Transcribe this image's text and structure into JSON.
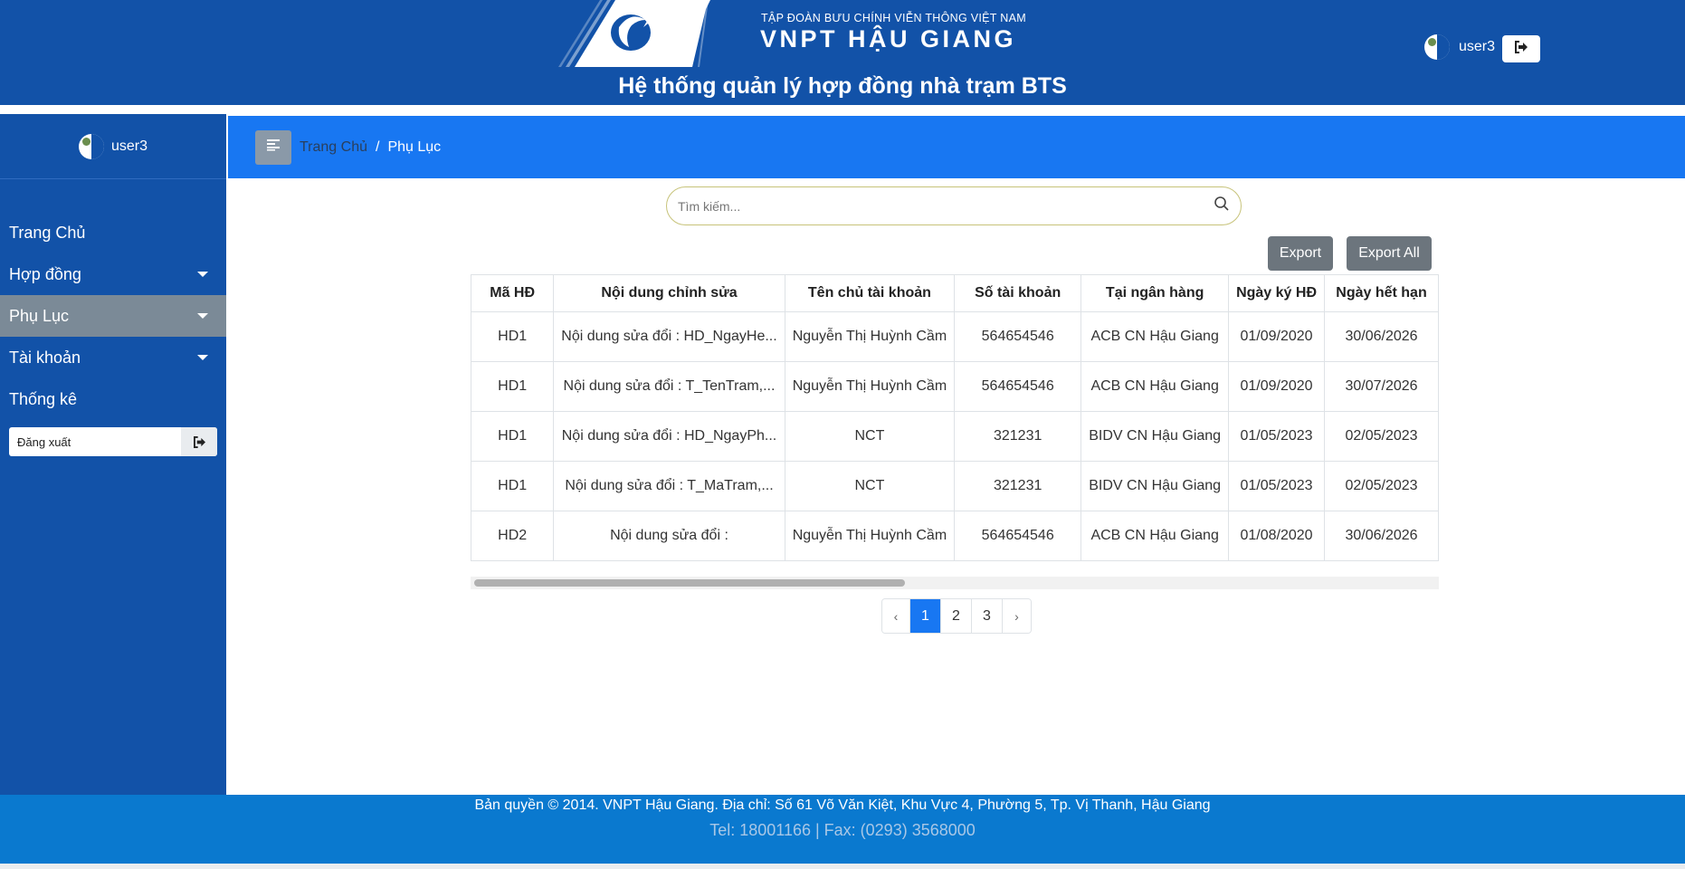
{
  "header": {
    "brand_sub": "TẬP ĐOÀN BƯU CHÍNH VIỄN THÔNG VIỆT NAM",
    "brand_main": "VNPT HẬU GIANG",
    "system_title": "Hệ thống quản lý hợp đồng nhà trạm BTS",
    "username": "user3"
  },
  "sidebar": {
    "username": "user3",
    "items": [
      {
        "label": "Trang Chủ",
        "has_caret": false,
        "active": false
      },
      {
        "label": "Hợp đồng",
        "has_caret": true,
        "active": false
      },
      {
        "label": "Phụ Lục",
        "has_caret": true,
        "active": true
      },
      {
        "label": "Tài khoản",
        "has_caret": true,
        "active": false
      },
      {
        "label": "Thống kê",
        "has_caret": false,
        "active": false
      }
    ],
    "logout_label": "Đăng xuất"
  },
  "breadcrumb": {
    "home": "Trang Chủ",
    "separator": "/",
    "current": "Phụ Lục"
  },
  "search": {
    "placeholder": "Tìm kiếm...",
    "value": ""
  },
  "toolbar": {
    "export_label": "Export",
    "export_all_label": "Export All"
  },
  "table": {
    "columns": [
      "Mã HĐ",
      "Nội dung chỉnh sửa",
      "Tên chủ tài khoản",
      "Số tài khoản",
      "Tại ngân hàng",
      "Ngày ký HĐ",
      "Ngày hết hạn"
    ],
    "rows": [
      [
        "HD1",
        "Nội dung sửa đổi : HD_NgayHe...",
        "Nguyễn Thị Huỳnh Cầm",
        "564654546",
        "ACB CN Hậu Giang",
        "01/09/2020",
        "30/06/2026"
      ],
      [
        "HD1",
        "Nội dung sửa đổi : T_TenTram,...",
        "Nguyễn Thị Huỳnh Cầm",
        "564654546",
        "ACB CN Hậu Giang",
        "01/09/2020",
        "30/07/2026"
      ],
      [
        "HD1",
        "Nội dung sửa đổi : HD_NgayPh...",
        "NCT",
        "321231",
        "BIDV CN Hậu Giang",
        "01/05/2023",
        "02/05/2023"
      ],
      [
        "HD1",
        "Nội dung sửa đổi : T_MaTram,...",
        "NCT",
        "321231",
        "BIDV CN Hậu Giang",
        "01/05/2023",
        "02/05/2023"
      ],
      [
        "HD2",
        "Nội dung sửa đổi :",
        "Nguyễn Thị Huỳnh Cầm",
        "564654546",
        "ACB CN Hậu Giang",
        "01/08/2020",
        "30/06/2026"
      ]
    ]
  },
  "pagination": {
    "prev": "‹",
    "pages": [
      "1",
      "2",
      "3"
    ],
    "current": "1",
    "next": "›"
  },
  "footer": {
    "line1": "Bản quyền © 2014. VNPT Hậu Giang. Địa chỉ: Số 61 Võ Văn Kiệt, Khu Vực 4, Phường 5, Tp. Vị Thanh, Hậu Giang",
    "line2": "Tel: 18001166 | Fax: (0293) 3568000"
  },
  "colors": {
    "header_blue": "#1252a8",
    "breadcrumb_blue": "#1877f2",
    "footer_blue": "#0a79cf",
    "active_menu_gray": "#7b8a97"
  }
}
